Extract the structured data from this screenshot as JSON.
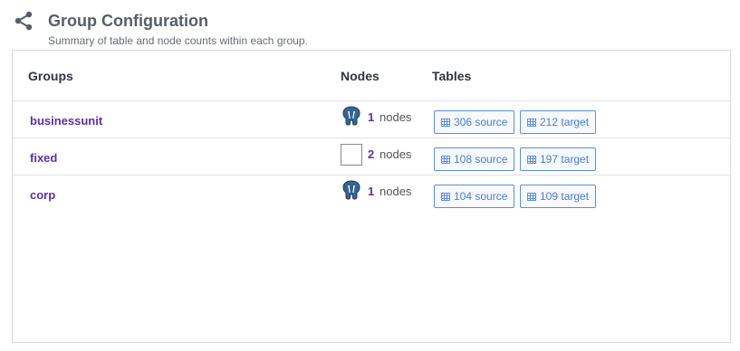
{
  "header": {
    "title": "Group Configuration",
    "subtitle": "Summary of table and node counts within each group."
  },
  "table": {
    "columns": [
      "Groups",
      "Nodes",
      "Tables"
    ],
    "rows": [
      {
        "group": "businessunit",
        "node_icon": "postgresql-elephant-icon",
        "node_count": "1",
        "node_label": "nodes",
        "source": "306 source",
        "target": "212 target"
      },
      {
        "group": "fixed",
        "node_icon": "blank-node-icon",
        "node_count": "2",
        "node_label": "nodes",
        "source": "108 source",
        "target": "197 target"
      },
      {
        "group": "corp",
        "node_icon": "postgresql-elephant-icon",
        "node_count": "1",
        "node_label": "nodes",
        "source": "104 source",
        "target": "109 target"
      }
    ]
  },
  "colors": {
    "accent": "#5a2fb0",
    "button_border": "#5b8ee0",
    "title": "#555e68"
  }
}
